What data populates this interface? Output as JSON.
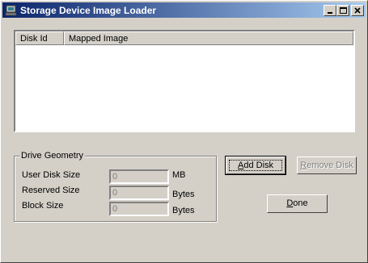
{
  "window": {
    "title": "Storage Device Image Loader",
    "controls": [
      "minimize-icon",
      "maximize-icon",
      "close-icon"
    ]
  },
  "disk_list": {
    "columns": [
      "Disk Id",
      "Mapped Image"
    ],
    "rows": []
  },
  "drive_geometry": {
    "title": "Drive Geometry",
    "fields": [
      {
        "label": "User Disk Size",
        "value": "0",
        "unit": "MB"
      },
      {
        "label": "Reserved Size",
        "value": "0",
        "unit": "Bytes"
      },
      {
        "label": "Block Size",
        "value": "0",
        "unit": "Bytes"
      }
    ]
  },
  "buttons": {
    "add_disk": {
      "pre": "",
      "accel": "A",
      "post": "dd Disk"
    },
    "remove_disk": {
      "pre": "",
      "accel": "R",
      "post": "emove Disk",
      "enabled": false
    },
    "done": {
      "pre": "",
      "accel": "D",
      "post": "one"
    }
  },
  "colors": {
    "titlebar_start": "#0a246a",
    "titlebar_end": "#a6caf0",
    "face": "#d4d0c8"
  }
}
